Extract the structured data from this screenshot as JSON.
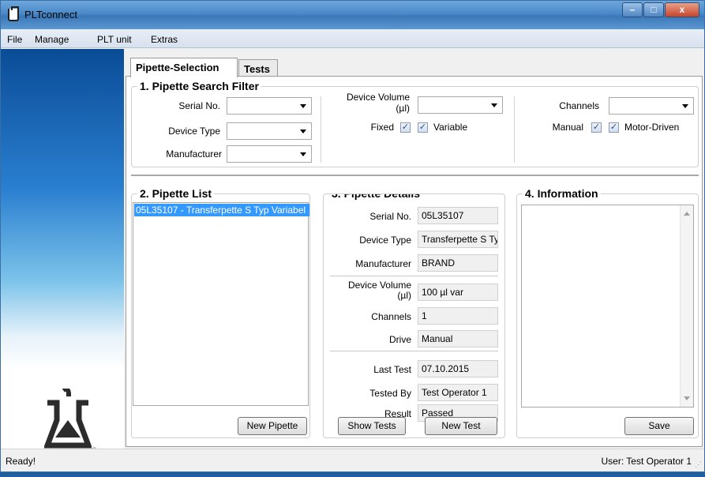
{
  "window": {
    "title": "PLTconnect",
    "controls": {
      "minimize": "–",
      "maximize": "□",
      "close": "x"
    }
  },
  "menu": {
    "items": [
      "File",
      "Manage",
      "PLT unit",
      "Extras"
    ]
  },
  "brand": {
    "name": "BRAND",
    "registered": "®"
  },
  "tabs": [
    {
      "label": "Pipette-Selection",
      "active": true
    },
    {
      "label": "Tests",
      "active": false
    }
  ],
  "search_filter": {
    "title": "1. Pipette Search Filter",
    "serial_no_label": "Serial No.",
    "device_type_label": "Device Type",
    "manufacturer_label": "Manufacturer",
    "device_volume_label": "Device Volume",
    "device_volume_unit": "(µl)",
    "fixed_label": "Fixed",
    "fixed_checked": true,
    "variable_label": "Variable",
    "variable_checked": true,
    "channels_label": "Channels",
    "manual_label": "Manual",
    "manual_checked": true,
    "motor_label": "Motor-Driven",
    "motor_checked": true
  },
  "pipette_list": {
    "title": "2. Pipette List",
    "items": [
      "05L35107 - Transferpette S Typ Variabel"
    ],
    "new_button": "New Pipette"
  },
  "details": {
    "title": "3. Pipette Details",
    "serial_label": "Serial No.",
    "serial_value": "05L35107",
    "type_label": "Device Type",
    "type_value": "Transferpette S Ty",
    "manufacturer_label": "Manufacturer",
    "manufacturer_value": "BRAND",
    "volume_label": "Device Volume",
    "volume_unit": "(µl)",
    "volume_value": "100 µl var",
    "channels_label": "Channels",
    "channels_value": "1",
    "drive_label": "Drive",
    "drive_value": "Manual",
    "last_test_label": "Last Test",
    "last_test_value": "07.10.2015",
    "tested_by_label": "Tested By",
    "tested_by_value": "Test Operator 1",
    "result_label": "Result",
    "result_value": "Passed",
    "show_tests_button": "Show Tests",
    "new_test_button": "New Test"
  },
  "information": {
    "title": "4. Information",
    "save_button": "Save"
  },
  "status": {
    "left": "Ready!",
    "right": "User: Test Operator 1"
  }
}
